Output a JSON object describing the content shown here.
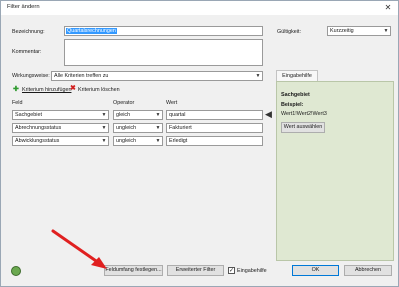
{
  "window": {
    "title": "Filter ändern",
    "close_glyph": "✕"
  },
  "form": {
    "bezeichnung_label": "Bezeichnung:",
    "bezeichnung_value": "Quartalsrechnungen",
    "kommentar_label": "Kommentar:",
    "gueltigkeit_label": "Gültigkeit:",
    "gueltigkeit_value": "Kurzzeitig",
    "wirkungsweise_label": "Wirkungsweise:",
    "wirkungsweise_value": "Alle Kriterien treffen zu"
  },
  "toolbar": {
    "add_label": "Kriterium hinzufügen",
    "delete_label": "Kriterium löschen"
  },
  "criteria": {
    "headers": [
      "Feld",
      "Operator",
      "Wert"
    ],
    "rows": [
      {
        "feld": "Sachgebiet",
        "operator": "gleich",
        "wert": "quartal"
      },
      {
        "feld": "Abrechnungsstatus",
        "operator": "ungleich",
        "wert": "Fakturiert"
      },
      {
        "feld": "Abwicklungsstatus",
        "operator": "ungleich",
        "wert": "Erledigt"
      }
    ]
  },
  "help": {
    "tab_label": "Eingabehilfe",
    "title": "Sachgebiet",
    "example_label": "Beispiel:",
    "example_value": "Wert1!Wert2!Wert3",
    "select_button": "Wert auswählen"
  },
  "footer": {
    "feldumfang_button": "Feldumfang festlegen...",
    "erweiterter_button": "Erweiterter Filter",
    "eingabehilfe_label": "Eingabehilfe",
    "eingabehilfe_checked": true,
    "ok_button": "OK",
    "abbrechen_button": "Abbrechen"
  },
  "colors": {
    "accent": "#0078d7",
    "panel_bg": "#dfe8d2",
    "arrow_annotation": "#e02020",
    "delete_icon": "#d22020",
    "add_icon": "#2f9a2f"
  }
}
